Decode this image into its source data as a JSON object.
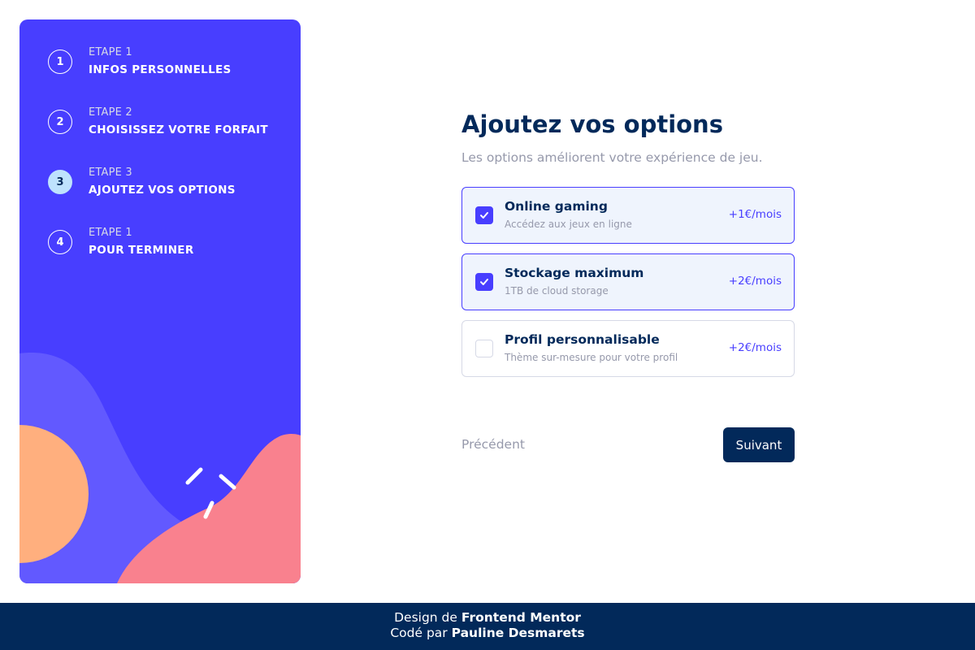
{
  "sidebar": {
    "steps": [
      {
        "number": "1",
        "label": "ETAPE 1",
        "title": "INFOS PERSONNELLES",
        "active": false
      },
      {
        "number": "2",
        "label": "ETAPE 2",
        "title": "CHOISISSEZ VOTRE FORFAIT",
        "active": false
      },
      {
        "number": "3",
        "label": "ETAPE 3",
        "title": "AJOUTEZ VOS OPTIONS",
        "active": true
      },
      {
        "number": "4",
        "label": "ETAPE 1",
        "title": "POUR TERMINER",
        "active": false
      }
    ]
  },
  "main": {
    "title": "Ajoutez vos options",
    "subtitle": "Les options améliorent votre expérience de jeu.",
    "addons": [
      {
        "name": "Online gaming",
        "description": "Accédez aux jeux en ligne",
        "price": "+1€/mois",
        "checked": true
      },
      {
        "name": "Stockage maximum",
        "description": "1TB de cloud storage",
        "price": "+2€/mois",
        "checked": true
      },
      {
        "name": "Profil personnalisable",
        "description": "Thème sur-mesure pour votre profil",
        "price": "+2€/mois",
        "checked": false
      }
    ],
    "back_label": "Précédent",
    "next_label": "Suivant"
  },
  "footer": {
    "design_prefix": "Design de",
    "design_name": "Frontend Mentor",
    "code_prefix": "Codé par",
    "code_name": "Pauline Desmarets"
  },
  "colors": {
    "purple": "#483eff",
    "marine_blue": "#02295a",
    "light_blue": "#bee2fd",
    "cool_gray": "#9699ab",
    "orange": "#ffaf7e",
    "pink": "#f9818e",
    "lavender": "#6259ff"
  }
}
